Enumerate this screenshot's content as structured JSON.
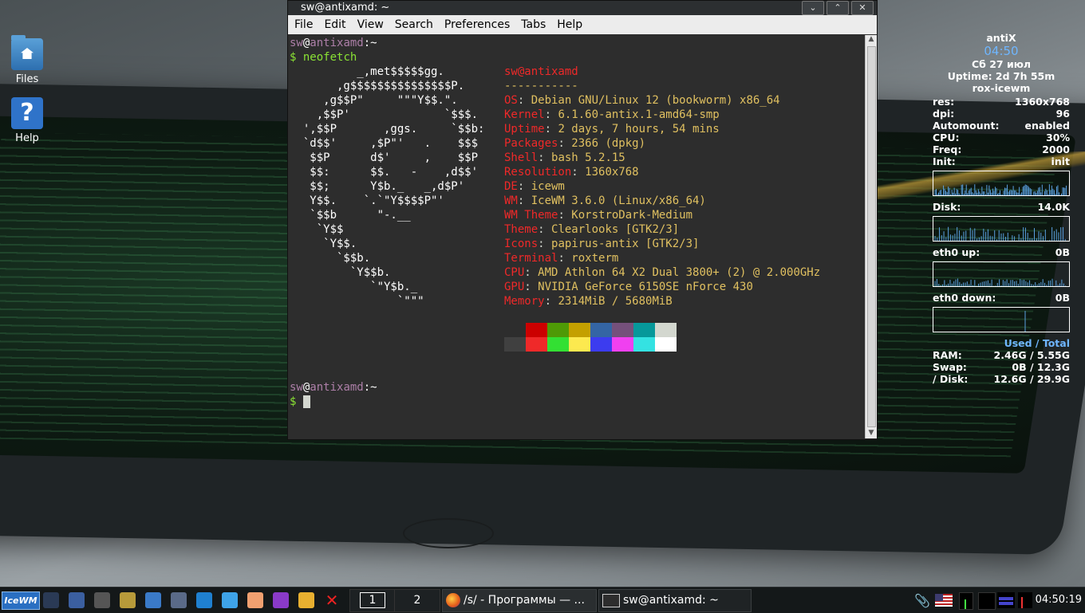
{
  "desktop": {
    "icons": [
      {
        "label": "Files",
        "icon": "folder-icon"
      },
      {
        "label": "Help",
        "icon": "help-icon"
      }
    ]
  },
  "window": {
    "title": "sw@antixamd: ~",
    "buttons": [
      "minimize",
      "maximize",
      "close"
    ],
    "menu": [
      "File",
      "Edit",
      "View",
      "Search",
      "Preferences",
      "Tabs",
      "Help"
    ]
  },
  "terminal": {
    "prompt_user": "sw",
    "prompt_at": "@",
    "prompt_host": "antixamd",
    "prompt_path": ":~",
    "prompt_symbol": "$",
    "command": "neofetch",
    "logo": [
      "          _,met$$$$$gg.",
      "       ,g$$$$$$$$$$$$$$$P.",
      "     ,g$$P\"     \"\"\"Y$$.\".",
      "    ,$$P'              `$$$.",
      "  ',$$P       ,ggs.     `$$b:",
      "  `d$$'     ,$P\"'   .    $$$",
      "   $$P      d$'     ,    $$P",
      "   $$:      $$.   -    ,d$$'",
      "   $$;      Y$b._   _,d$P'",
      "   Y$$.    `.`\"Y$$$$P\"'",
      "   `$$b      \"-.__",
      "    `Y$$",
      "     `Y$$.",
      "       `$$b.",
      "         `Y$$b.",
      "            `\"Y$b._",
      "                `\"\"\""
    ],
    "user_host": "sw@antixamd",
    "separator": "-----------",
    "info": [
      {
        "label": "OS",
        "value": "Debian GNU/Linux 12 (bookworm) x86_64"
      },
      {
        "label": "Kernel",
        "value": "6.1.60-antix.1-amd64-smp"
      },
      {
        "label": "Uptime",
        "value": "2 days, 7 hours, 54 mins"
      },
      {
        "label": "Packages",
        "value": "2366 (dpkg)"
      },
      {
        "label": "Shell",
        "value": "bash 5.2.15"
      },
      {
        "label": "Resolution",
        "value": "1360x768"
      },
      {
        "label": "DE",
        "value": "icewm"
      },
      {
        "label": "WM",
        "value": "IceWM 3.6.0 (Linux/x86_64)"
      },
      {
        "label": "WM Theme",
        "value": "KorstroDark-Medium"
      },
      {
        "label": "Theme",
        "value": "Clearlooks [GTK2/3]"
      },
      {
        "label": "Icons",
        "value": "papirus-antix [GTK2/3]"
      },
      {
        "label": "Terminal",
        "value": "roxterm"
      },
      {
        "label": "CPU",
        "value": "AMD Athlon 64 X2 Dual 3800+ (2) @ 2.000GHz"
      },
      {
        "label": "GPU",
        "value": "NVIDIA GeForce 6150SE nForce 430"
      },
      {
        "label": "Memory",
        "value": "2314MiB / 5680MiB"
      }
    ],
    "palette_top": [
      "#2d2d2d",
      "#cc0000",
      "#4e9a06",
      "#c4a000",
      "#3465a4",
      "#75507b",
      "#06989a",
      "#d3d7cf"
    ],
    "palette_bottom": [
      "#404040",
      "#ef2929",
      "#33e033",
      "#fce94f",
      "#3c3cef",
      "#f040f0",
      "#34e2e2",
      "#ffffff"
    ]
  },
  "conky": {
    "title": "antiX",
    "time": "04:50",
    "date": "Сб 27 июл",
    "uptime": "Uptime: 2d 7h 55m",
    "wm": "rox-icewm",
    "stats": [
      {
        "k": "res:",
        "v": "1360x768"
      },
      {
        "k": "dpi:",
        "v": "96"
      },
      {
        "k": "Automount:",
        "v": "enabled"
      },
      {
        "k": "CPU:",
        "v": "30%"
      },
      {
        "k": "Freq:",
        "v": "2000"
      },
      {
        "k": "Init:",
        "v": "init"
      }
    ],
    "disk_label": "Disk:",
    "disk_value": "14.0K",
    "eth_up_label": "eth0 up:",
    "eth_up_value": "0B",
    "eth_down_label": "eth0 down:",
    "eth_down_value": "0B",
    "used_total": "Used / Total",
    "mem": [
      {
        "k": "RAM:",
        "v": "2.46G / 5.55G"
      },
      {
        "k": "Swap:",
        "v": "0B   / 12.3G"
      },
      {
        "k": "/ Disk:",
        "v": "12.6G / 29.9G"
      }
    ]
  },
  "taskbar": {
    "start_label": "IceWM",
    "quicklaunch": [
      "show-desktop-icon",
      "window-list-icon",
      "terminal-icon",
      "file-manager-icon",
      "safari-compass-icon",
      "image-viewer-icon",
      "network-icon",
      "weather-icon",
      "peach-icon",
      "media-player-icon",
      "hand-icon",
      "close-x-icon"
    ],
    "workspaces": [
      "1",
      "2"
    ],
    "tasks": [
      {
        "label": "/s/ - Программы — ...",
        "icon": "firefox-icon"
      },
      {
        "label": "sw@antixamd: ~",
        "icon": "terminal-icon"
      }
    ],
    "clock": "04:50:19"
  }
}
